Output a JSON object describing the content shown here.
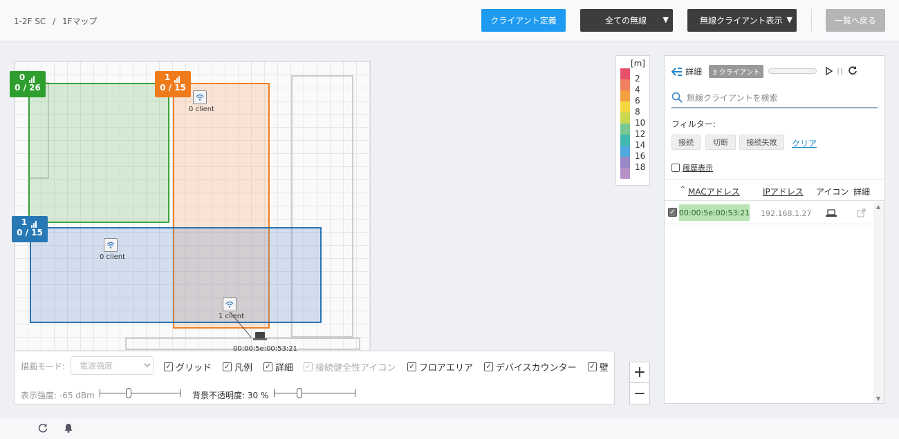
{
  "breadcrumb": {
    "item1": "1-2F SC",
    "sep": "/",
    "item2": "1Fマップ"
  },
  "header": {
    "client_def_btn": "クライアント定義",
    "all_wireless_btn": "全ての無線",
    "wireless_client_btn": "無線クライアント表示",
    "back_btn": "一覧へ戻る",
    "caret": "▼"
  },
  "map": {
    "zones": [
      {
        "count": "0",
        "ratio": "0 / 26",
        "color": "#2e9e2e"
      },
      {
        "count": "1",
        "ratio": "0 / 15",
        "color": "#f07b1a"
      },
      {
        "count": "1",
        "ratio": "0 / 15",
        "color": "#2878b5"
      }
    ],
    "aps": [
      {
        "label": "0 client"
      },
      {
        "label": "0 client"
      },
      {
        "label": "1 client"
      }
    ],
    "client_label": "00:00:5e:00:53:21"
  },
  "legend": {
    "unit": "[m]",
    "items": [
      {
        "label": "2",
        "color": "#e8506a"
      },
      {
        "label": "4",
        "color": "#f08060"
      },
      {
        "label": "6",
        "color": "#f5a040"
      },
      {
        "label": "8",
        "color": "#f5d840"
      },
      {
        "label": "10",
        "color": "#c8d850"
      },
      {
        "label": "12",
        "color": "#78c890"
      },
      {
        "label": "14",
        "color": "#40b8b0"
      },
      {
        "label": "16",
        "color": "#50a8e0"
      },
      {
        "label": "18",
        "color": "#9888c8"
      }
    ],
    "extra_color": "#b890c8"
  },
  "controls": {
    "draw_mode_label": "描画モード:",
    "draw_mode_value": "電波強度",
    "grid": "グリッド",
    "legend": "凡例",
    "detail": "詳細",
    "health_icon": "接続健全性アイコン",
    "floor_area": "フロアエリア",
    "device_counter": "デバイスカウンター",
    "wall": "壁",
    "strength_label": "表示強度: -65 dBm",
    "opacity_label": "背景不透明度: 30 %",
    "strength_fraction": 0.35,
    "opacity_fraction": 0.3
  },
  "zoom": {
    "plus": "+",
    "minus": "−"
  },
  "panel": {
    "title": "詳細",
    "client_badge": "3 クライアント",
    "search_placeholder": "無線クライアントを検索",
    "filter_label": "フィルター:",
    "filter_connected": "接続",
    "filter_disconnected": "切断",
    "filter_failed": "接続失敗",
    "clear": "クリア",
    "history": "履歴表示",
    "col_mac": "MACアドレス",
    "col_ip": "IPアドレス",
    "col_icon": "アイコン",
    "col_detail": "詳細",
    "rows": [
      {
        "mac": "00:00:5e:00:53:21",
        "ip": "192.168.1.27"
      }
    ]
  }
}
